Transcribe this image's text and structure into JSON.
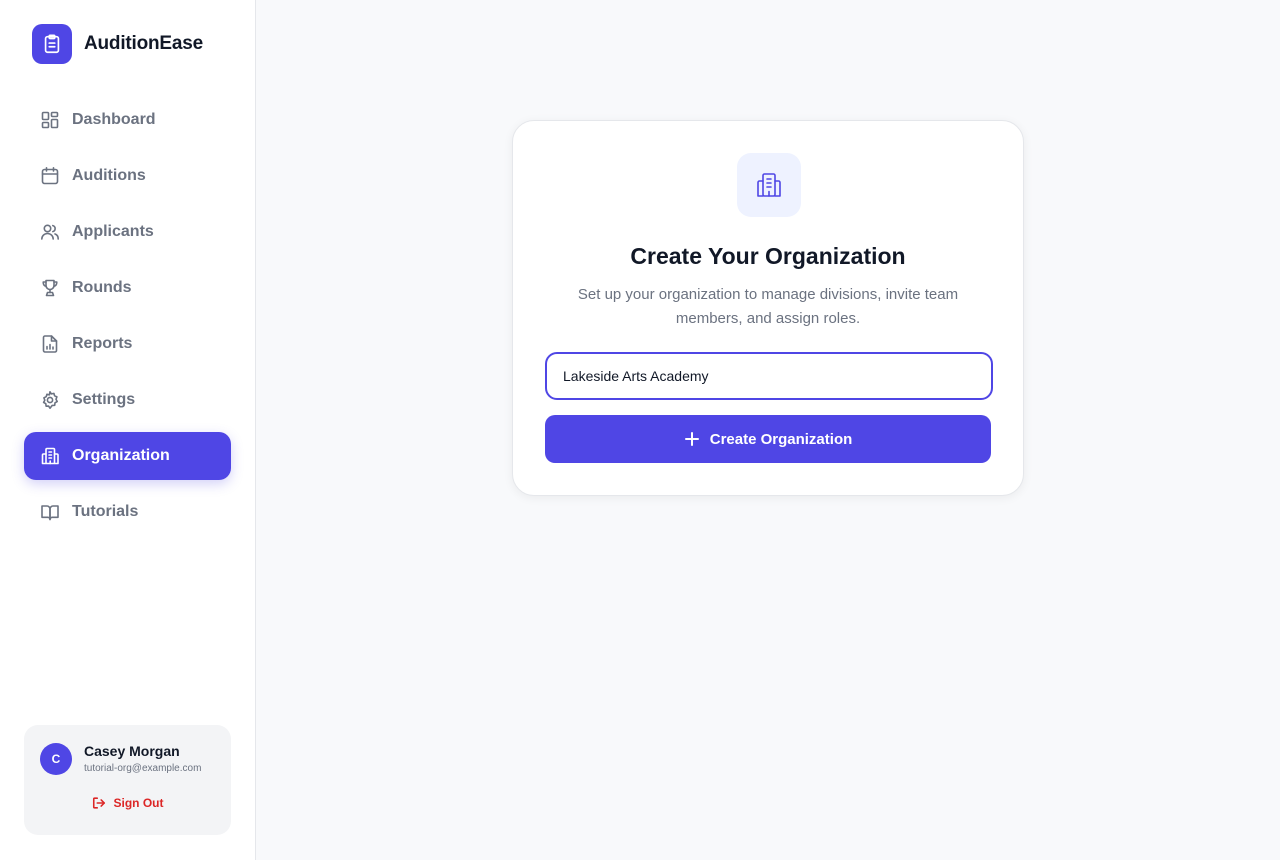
{
  "app": {
    "name": "AuditionEase",
    "logo_icon": "clipboard-icon"
  },
  "sidebar": {
    "items": [
      {
        "label": "Dashboard",
        "icon": "dashboard-icon",
        "active": false
      },
      {
        "label": "Auditions",
        "icon": "calendar-icon",
        "active": false
      },
      {
        "label": "Applicants",
        "icon": "users-icon",
        "active": false
      },
      {
        "label": "Rounds",
        "icon": "trophy-icon",
        "active": false
      },
      {
        "label": "Reports",
        "icon": "report-icon",
        "active": false
      },
      {
        "label": "Settings",
        "icon": "gear-icon",
        "active": false
      },
      {
        "label": "Organization",
        "icon": "building-icon",
        "active": true
      },
      {
        "label": "Tutorials",
        "icon": "book-icon",
        "active": false
      }
    ]
  },
  "user": {
    "initial": "C",
    "name": "Casey Morgan",
    "email": "tutorial-org@example.com",
    "signout_label": "Sign Out"
  },
  "main": {
    "card": {
      "icon": "building-icon",
      "title": "Create Your Organization",
      "subtitle": "Set up your organization to manage divisions, invite team members, and assign roles.",
      "input_value": "Lakeside Arts Academy",
      "button_label": "Create Organization"
    }
  },
  "colors": {
    "accent": "#4f46e5",
    "danger": "#dc2626",
    "background": "#f8f9fb"
  }
}
